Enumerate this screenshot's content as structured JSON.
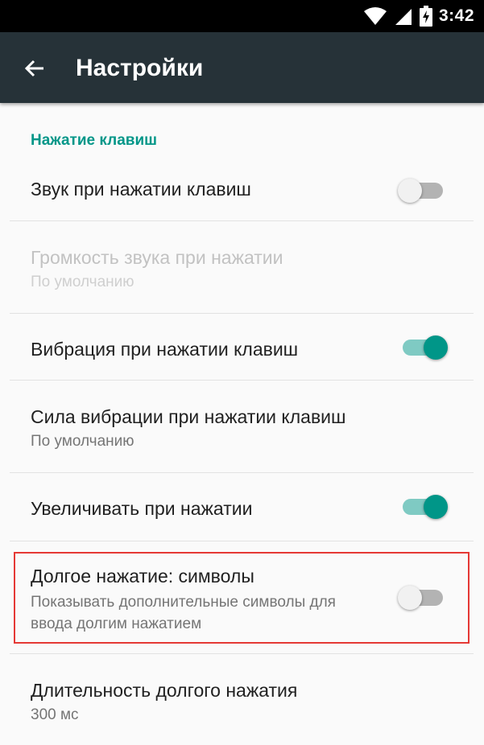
{
  "status_bar": {
    "time": "3:42",
    "icons": [
      "wifi-icon",
      "cell-signal-icon",
      "battery-charging-icon"
    ]
  },
  "toolbar": {
    "back_icon": "arrow-back-icon",
    "title": "Настройки"
  },
  "category": "Нажатие клавиш",
  "settings": [
    {
      "title": "Звук при нажатии клавиш",
      "summary": "",
      "switch": "off",
      "enabled": true
    },
    {
      "title": "Громкость звука при нажатии",
      "summary": "По умолчанию",
      "enabled": false
    },
    {
      "title": "Вибрация при нажатии клавиш",
      "summary": "",
      "switch": "on",
      "enabled": true
    },
    {
      "title": "Сила вибрации при нажатии клавиш",
      "summary": "По умолчанию",
      "enabled": true
    },
    {
      "title": "Увеличивать при нажатии",
      "summary": "",
      "switch": "on",
      "enabled": true
    },
    {
      "title": "Долгое нажатие: символы",
      "summary": "Показывать дополнительные символы для ввода долгим нажатием",
      "switch": "off",
      "enabled": true,
      "highlighted": true
    },
    {
      "title": "Длительность долгого нажатия",
      "summary": "300 мс",
      "enabled": true
    }
  ],
  "colors": {
    "toolbar": "#263238",
    "accent": "#009688",
    "highlight": "#e53935"
  }
}
